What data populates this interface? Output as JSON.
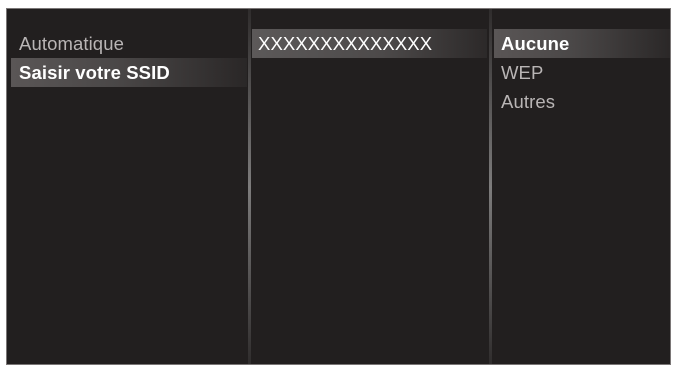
{
  "network_setup": {
    "connection_methods": [
      {
        "label": "Automatique",
        "selected": false
      },
      {
        "label": "Saisir votre SSID",
        "selected": true
      }
    ],
    "ssid": {
      "value": "XXXXXXXXXXXXXX",
      "selected": true
    },
    "security_options": [
      {
        "label": "Aucune",
        "selected": true
      },
      {
        "label": "WEP",
        "selected": false
      },
      {
        "label": "Autres",
        "selected": false
      }
    ]
  },
  "colors": {
    "background": "#221f1f",
    "text": "#b9b5b5",
    "selected_text": "#ffffff",
    "highlight": "#4d4a4a"
  }
}
